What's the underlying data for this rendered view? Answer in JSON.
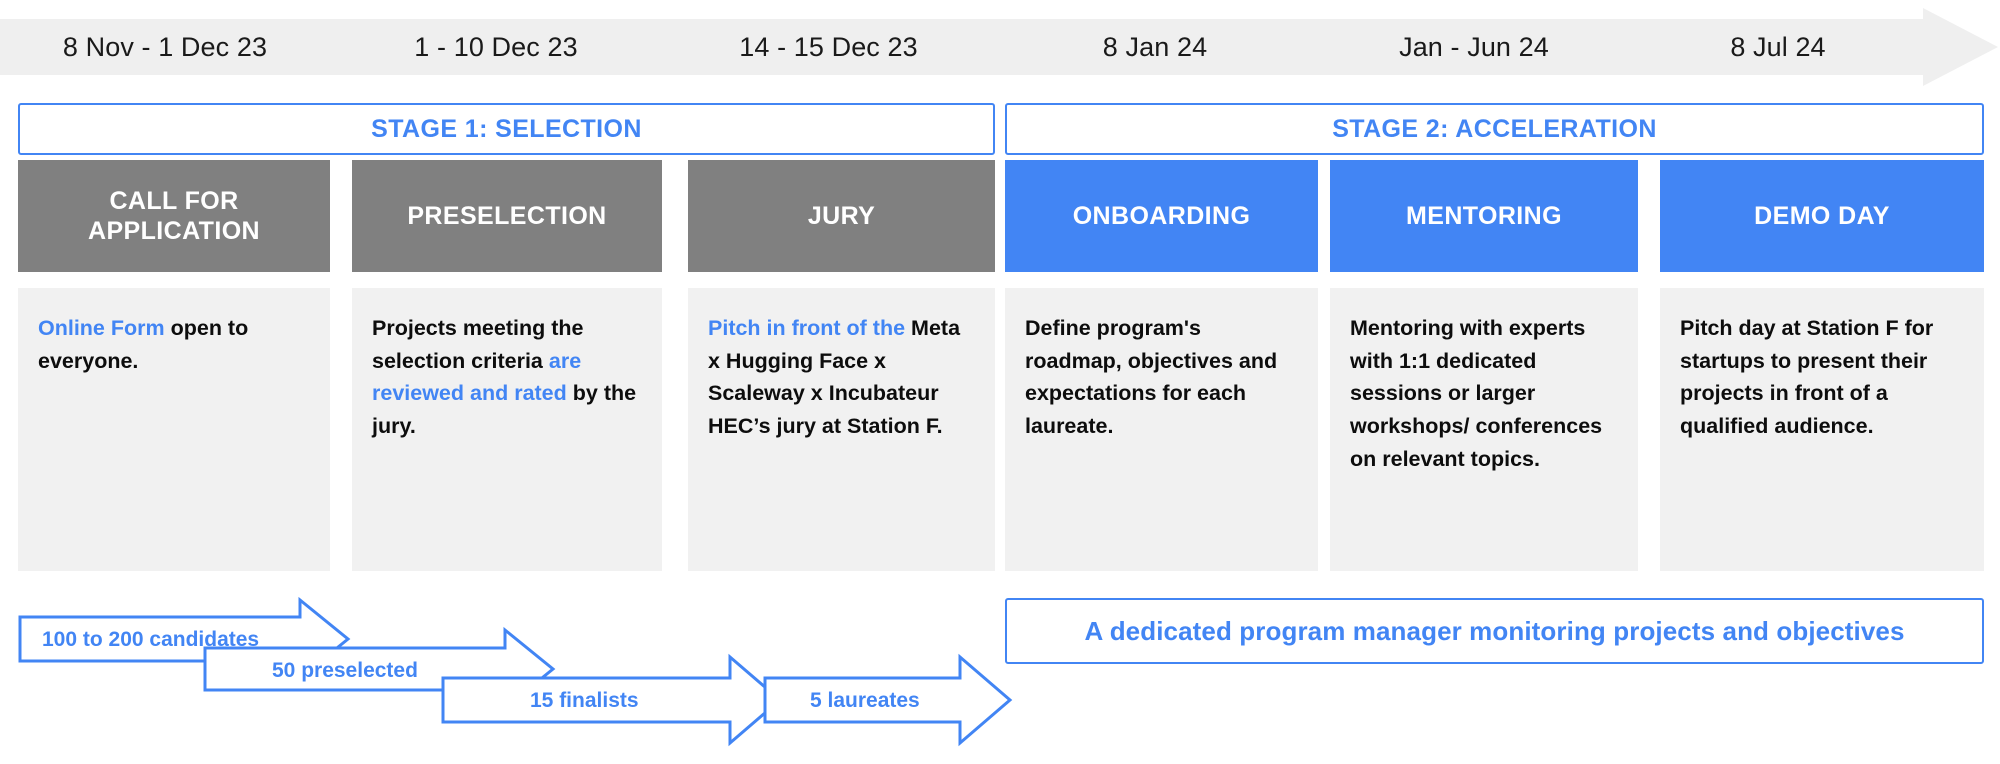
{
  "timeline": {
    "periods": [
      "8 Nov - 1 Dec 23",
      "1 - 10 Dec 23",
      "14 - 15 Dec 23",
      "8 Jan 24",
      "Jan - Jun 24",
      "8 Jul 24"
    ]
  },
  "stages": [
    {
      "id": "stage-1",
      "label": "STAGE 1: SELECTION"
    },
    {
      "id": "stage-2",
      "label": "STAGE 2: ACCELERATION"
    }
  ],
  "phases": [
    {
      "title": "CALL FOR APPLICATION",
      "title_line1": "CALL FOR",
      "title_line2": "APPLICATION",
      "color": "#808080",
      "body_parts": [
        {
          "text": "Online Form",
          "highlight": true
        },
        {
          "text": " open to everyone.",
          "highlight": false
        }
      ],
      "body_plain": "Online Form open to everyone."
    },
    {
      "title": "PRESELECTION",
      "color": "#808080",
      "body_parts": [
        {
          "text": "Projects meeting the selection criteria ",
          "highlight": false
        },
        {
          "text": "are reviewed and rated",
          "highlight": true
        },
        {
          "text": " by the jury.",
          "highlight": false
        }
      ],
      "body_plain": "Projects meeting the selection criteria are reviewed and rated by the jury."
    },
    {
      "title": "JURY",
      "color": "#808080",
      "body_parts": [
        {
          "text": "Pitch in front of the",
          "highlight": true
        },
        {
          "text": " Meta x Hugging Face x Scaleway x Incubateur HEC’s jury at Station F.",
          "highlight": false
        }
      ],
      "body_plain": "Pitch in front of the Meta x Hugging Face x Scaleway x Incubateur HEC’s jury at Station F."
    },
    {
      "title": "ONBOARDING",
      "color": "#4285f4",
      "body_parts": [
        {
          "text": "Define program's roadmap, objectives and expectations for each laureate.",
          "highlight": false
        }
      ],
      "body_plain": "Define program's roadmap, objectives and expectations for each laureate."
    },
    {
      "title": "MENTORING",
      "color": "#4285f4",
      "body_parts": [
        {
          "text": "Mentoring with experts with 1:1 dedicated sessions or larger workshops/ conferences on relevant topics.",
          "highlight": false
        }
      ],
      "body_plain": "Mentoring with experts with 1:1 dedicated sessions or larger workshops/ conferences on relevant topics."
    },
    {
      "title": "DEMO DAY",
      "color": "#4285f4",
      "body_parts": [
        {
          "text": "Pitch day at Station F for startups to present their projects in front of a qualified audience.",
          "highlight": false
        }
      ],
      "body_plain": "Pitch day at Station F for startups to present their projects in front of a qualified audience."
    }
  ],
  "funnel": {
    "steps": [
      {
        "label": "100 to 200 candidates"
      },
      {
        "label": "50 preselected"
      },
      {
        "label": "15 finalists"
      },
      {
        "label": "5 laureates"
      }
    ]
  },
  "program_manager": {
    "label": "A dedicated program manager monitoring projects and objectives"
  },
  "colors": {
    "accent_blue": "#4285f4",
    "phase_grey": "#808080",
    "band_grey": "#efefef",
    "body_bg": "#f1f1f1",
    "text_dark": "#0d0d0d"
  },
  "icons": {
    "timeline_arrow": "right-arrow-icon",
    "funnel_arrow": "right-chevron-arrow-icon"
  }
}
